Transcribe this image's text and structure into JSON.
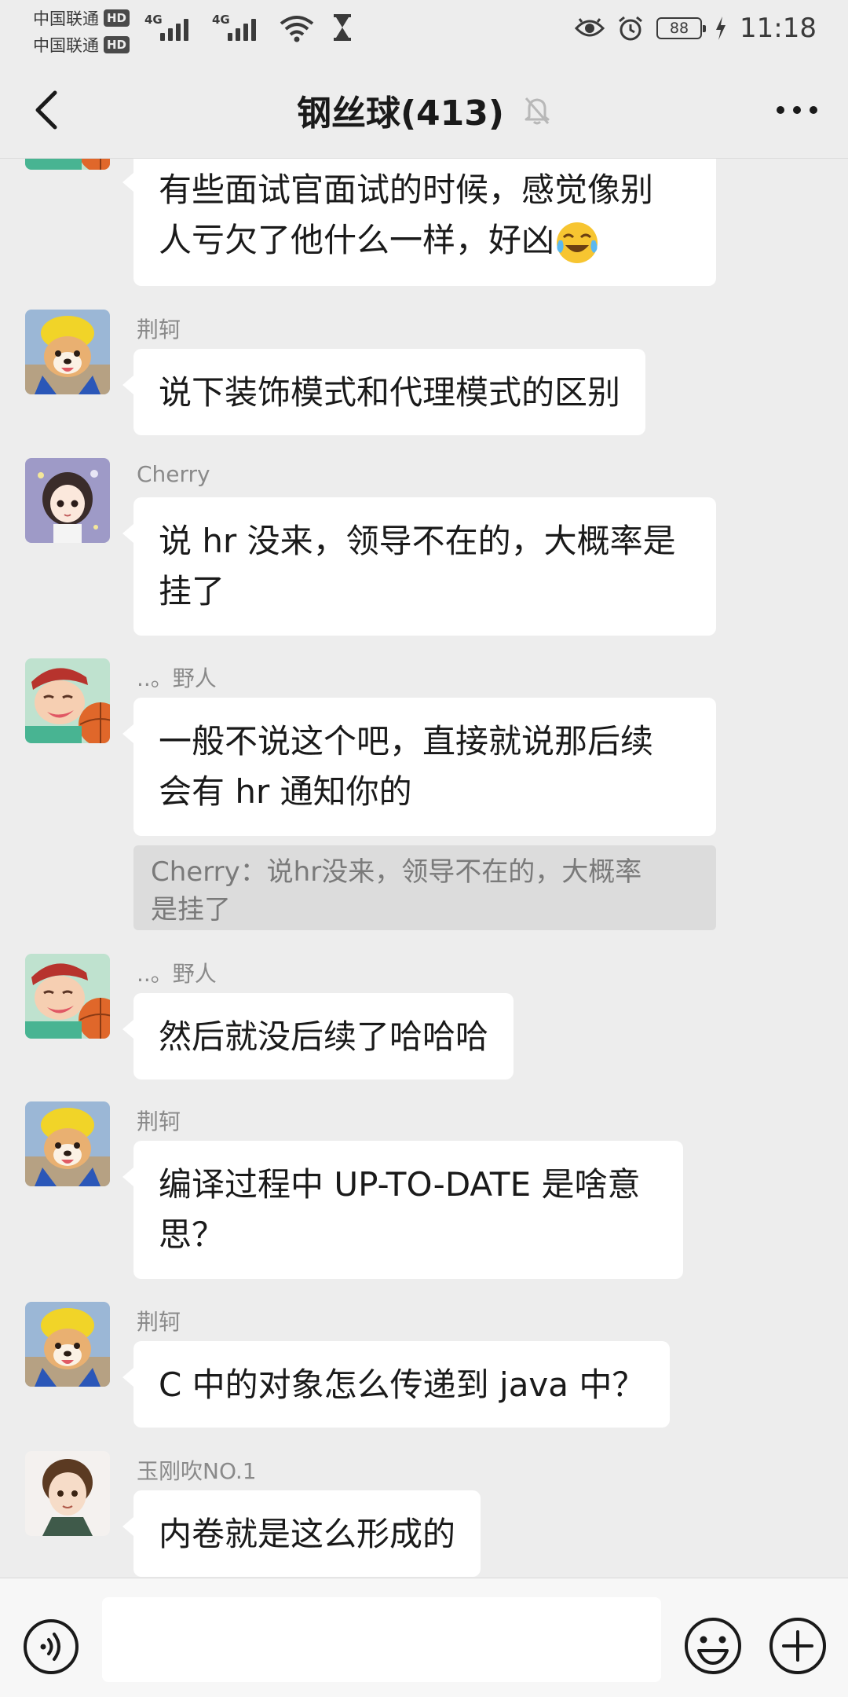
{
  "status_bar": {
    "carriers": [
      {
        "name": "中国联通",
        "badge": "HD"
      },
      {
        "name": "中国联通",
        "badge": "HD"
      }
    ],
    "network_tag": "4G",
    "battery": "88",
    "time": "11:18"
  },
  "header": {
    "title": "钢丝球(413)",
    "muted_icon": "bell-off-icon",
    "back_icon": "chevron-left-icon",
    "more_icon": "more-horizontal-icon"
  },
  "messages": [
    {
      "sender": "",
      "lines": [
        "有些面试官面试的时候，感觉像别",
        "人亏欠了他什么一样，好凶"
      ],
      "emoji": "laughing-crying-emoji",
      "avatar": "basketball-boy"
    },
    {
      "sender": "荆轲",
      "lines": [
        "说下装饰模式和代理模式的区别"
      ],
      "avatar": "shiba-yellow-hat"
    },
    {
      "sender": "Cherry",
      "lines": [
        "说 hr 没来，领导不在的，大概率是",
        "挂了"
      ],
      "avatar": "cartoon-girl"
    },
    {
      "sender": "..。野人",
      "lines": [
        "一般不说这个吧，直接就说那后续",
        "会有 hr 通知你的"
      ],
      "quote_lines": [
        "Cherry：说hr没来，领导不在的，大概率",
        "是挂了"
      ],
      "avatar": "basketball-boy"
    },
    {
      "sender": "..。野人",
      "lines": [
        "然后就没后续了哈哈哈"
      ],
      "avatar": "basketball-boy"
    },
    {
      "sender": "荆轲",
      "lines": [
        "编译过程中 UP-TO-DATE 是啥意",
        "思？"
      ],
      "avatar": "shiba-yellow-hat"
    },
    {
      "sender": "荆轲",
      "lines": [
        "C 中的对象怎么传递到 java 中？"
      ],
      "avatar": "shiba-yellow-hat"
    },
    {
      "sender": "玉刚吹NO.1",
      "lines": [
        "内卷就是这么形成的"
      ],
      "avatar": "anime-boy"
    }
  ],
  "input_bar": {
    "voice_icon": "voice-icon",
    "placeholder": "",
    "emoji_icon": "smiley-icon",
    "plus_icon": "plus-circle-icon"
  }
}
